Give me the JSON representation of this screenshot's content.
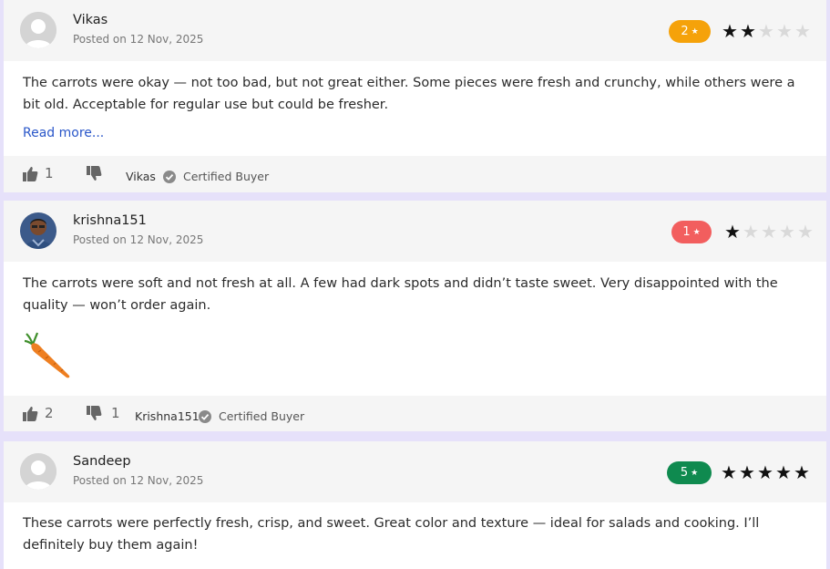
{
  "reviews": [
    {
      "name": "Vikas",
      "date": "Posted on 12 Nov, 2025",
      "rating": "2",
      "badge_color": "#f5a20a",
      "stars_filled": 2,
      "stars_total": 5,
      "text": "The carrots were okay — not too bad, but not great either. Some pieces were fresh and crunchy, while others were a bit old. Acceptable for regular use but could be fresher.",
      "read_more": "Read more...",
      "likes": "1",
      "dislikes": "",
      "author": "Vikas",
      "certified": "Certified Buyer"
    },
    {
      "name": "krishna151",
      "date": "Posted on 12 Nov, 2025",
      "rating": "1",
      "badge_color": "#f25e5e",
      "stars_filled": 1,
      "stars_total": 5,
      "text": "The carrots were soft and not fresh at all. A few had dark spots and didn’t taste sweet. Very disappointed with the quality — won’t order again.",
      "likes": "2",
      "dislikes": "1",
      "author": "Krishna151",
      "certified": "Certified Buyer"
    },
    {
      "name": "Sandeep",
      "date": "Posted on 12 Nov, 2025",
      "rating": "5",
      "badge_color": "#0f8a4f",
      "stars_filled": 5,
      "stars_total": 5,
      "text": "These carrots were perfectly fresh, crisp, and sweet. Great color and texture — ideal for salads and cooking. I’ll definitely buy them again!"
    }
  ],
  "icons": {
    "star": "★",
    "like": "thumbs-up-icon",
    "dislike": "thumbs-down-icon",
    "verified": "check-circle-icon",
    "avatar_placeholder": "user-avatar-icon",
    "review_photo": "carrot-icon"
  }
}
